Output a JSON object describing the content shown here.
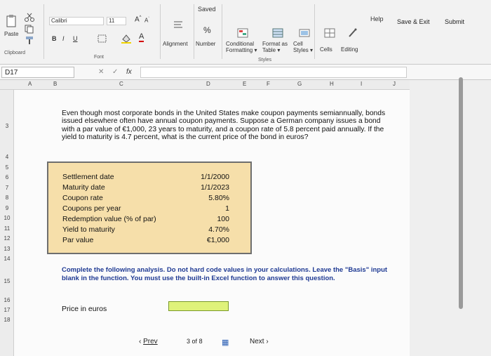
{
  "ribbon": {
    "saved": "Saved",
    "paste": "Paste",
    "clipboard": "Clipboard",
    "font_name": "Calibri",
    "font_size": "11",
    "bold": "B",
    "italic": "I",
    "underline": "U",
    "font_group": "Font",
    "alignment": "Alignment",
    "number": "Number",
    "percent_symbol": "%",
    "conditional_formatting_line1": "Conditional",
    "conditional_formatting_line2": "Formatting",
    "format_as_table_line1": "Format as",
    "format_as_table_line2": "Table",
    "cell_styles_line1": "Cell",
    "cell_styles_line2": "Styles",
    "styles_group": "Styles",
    "cells": "Cells",
    "editing": "Editing",
    "help": "Help"
  },
  "top_right": {
    "save_exit": "Save & Exit",
    "submit": "Submit"
  },
  "formula_bar": {
    "cell_ref": "D17",
    "fx": "fx"
  },
  "columns": [
    "A",
    "B",
    "C",
    "D",
    "E",
    "F",
    "G",
    "H",
    "I",
    "J"
  ],
  "rows": [
    "3",
    "4",
    "5",
    "6",
    "7",
    "8",
    "9",
    "10",
    "11",
    "12",
    "13",
    "14",
    "15",
    "16",
    "17",
    "18"
  ],
  "question": "Even though most corporate bonds in the United States make coupon payments semiannually, bonds issued elsewhere often have annual coupon payments. Suppose a German company issues a bond with a par value of €1,000, 23 years to maturity, and a coupon rate of 5.8 percent paid annually. If the yield to maturity is 4.7 percent, what is the current price of the bond in euros?",
  "inputs": [
    {
      "label": "Settlement date",
      "value": "1/1/2000"
    },
    {
      "label": "Maturity date",
      "value": "1/1/2023"
    },
    {
      "label": "Coupon rate",
      "value": "5.80%"
    },
    {
      "label": "Coupons per year",
      "value": "1"
    },
    {
      "label": "Redemption value (% of par)",
      "value": "100"
    },
    {
      "label": "Yield to maturity",
      "value": "4.70%"
    },
    {
      "label": "Par value",
      "value": "€1,000"
    }
  ],
  "instruction": "Complete the following analysis. Do not hard code values in your calculations. Leave the \"Basis\" input blank in the function. You must use the built-in Excel function to answer this question.",
  "price_label": "Price in euros",
  "nav": {
    "prev": "Prev",
    "page_current": "3",
    "page_of": "of",
    "page_total": "8",
    "next": "Next"
  }
}
